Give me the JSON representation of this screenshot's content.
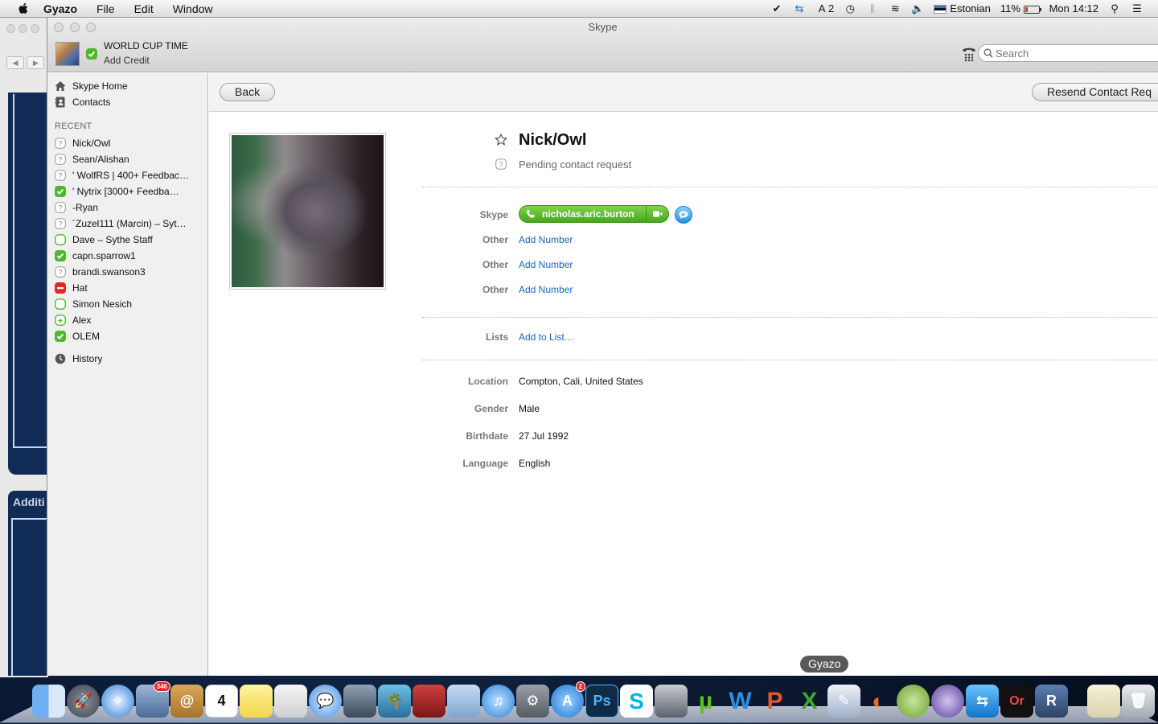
{
  "menubar": {
    "app": "Gyazo",
    "menus": [
      "File",
      "Edit",
      "Window"
    ],
    "status_count": "2",
    "input_source": "Estonian",
    "battery": "11%",
    "clock": "Mon 14:12"
  },
  "background": {
    "label": "Additi"
  },
  "window": {
    "title": "Skype",
    "profile_name": "WORLD CUP TIME",
    "add_credit": "Add Credit",
    "search_placeholder": "Search"
  },
  "sidebar": {
    "home": "Skype Home",
    "contacts": "Contacts",
    "recent_header": "RECENT",
    "recent": [
      {
        "name": "Nick/Owl",
        "status": "unknown"
      },
      {
        "name": "Sean/Alishan",
        "status": "unknown"
      },
      {
        "name": "' WolfRS | 400+ Feedback…",
        "status": "unknown"
      },
      {
        "name": "'    Nytrix [3000+ Feedba…",
        "status": "online"
      },
      {
        "name": "-Ryan",
        "status": "unknown"
      },
      {
        "name": "´Zuzel111 (Marcin) – Syt…",
        "status": "unknown"
      },
      {
        "name": "Dave – Sythe Staff",
        "status": "offline"
      },
      {
        "name": "capn.sparrow1",
        "status": "online"
      },
      {
        "name": "brandi.swanson3",
        "status": "unknown"
      },
      {
        "name": "Hat",
        "status": "dnd"
      },
      {
        "name": "Simon Nesich",
        "status": "offline"
      },
      {
        "name": "Alex",
        "status": "away"
      },
      {
        "name": "OLEM",
        "status": "online"
      }
    ],
    "history": "History"
  },
  "toolbar": {
    "back": "Back",
    "resend": "Resend Contact Req"
  },
  "contact": {
    "name": "Nick/Owl",
    "status_text": "Pending contact request",
    "skype_label": "Skype",
    "skype_name": "nicholas.aric.burton",
    "other_label": "Other",
    "add_number": "Add Number",
    "lists_label": "Lists",
    "add_to_list": "Add to List…",
    "location_label": "Location",
    "location": "Compton, Cali, United States",
    "gender_label": "Gender",
    "gender": "Male",
    "birthdate_label": "Birthdate",
    "birthdate": "27 Jul 1992",
    "language_label": "Language",
    "language": "English"
  },
  "dock": {
    "tooltip": "Gyazo",
    "mail_badge": "346",
    "appstore_badge": "2",
    "calendar_day": "4",
    "photoshop": "Ps",
    "orange": "Or"
  },
  "colors": {
    "online": "#4fb82a",
    "dnd": "#e0262b",
    "link": "#1a66b8",
    "skype_green": "#45a81c"
  }
}
